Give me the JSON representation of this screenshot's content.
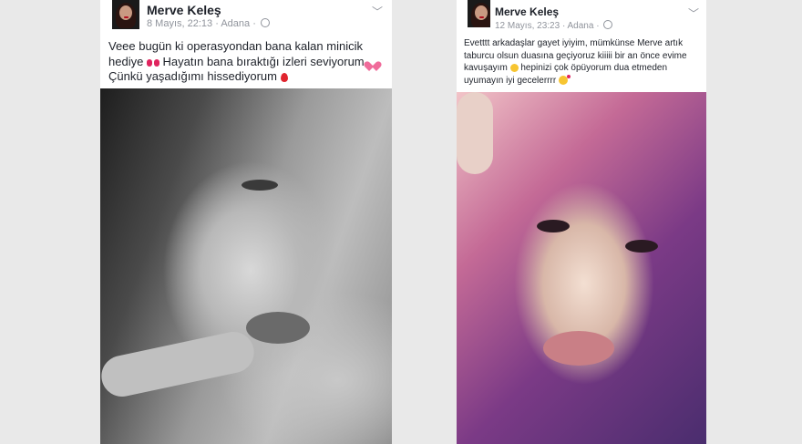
{
  "posts": [
    {
      "author": "Merve Keleş",
      "date": "8 Mayıs, 22:13",
      "sep": "·",
      "location": "Adana",
      "sep2": "·",
      "text_parts": [
        "Veee bugün ki operasyondan bana kalan minicik hediye ",
        " Hayatın bana bıraktığı izleri seviyorum ",
        " Çünkü yaşadığımı hissediyorum "
      ]
    },
    {
      "author": "Merve Keleş",
      "date": "12 Mayıs, 23:23",
      "sep": "·",
      "location": "Adana",
      "sep2": "·",
      "text_parts": [
        "Evetttt arkadaşlar gayet iyiyim, mümkünse Merve artık taburcu olsun duasına geçiyoruz kiiiii bir an önce evime kavuşayım ",
        " hepinizi çok öpüyorum dua etmeden uyumayın iyi gecelerrrr "
      ]
    }
  ],
  "icons": {
    "chevron": "chevron-down-icon",
    "globe": "globe-icon",
    "emoji_post1": [
      "bow-emoji",
      "heart-emoji",
      "balloon-emoji"
    ],
    "emoji_post2": [
      "smile-emoji",
      "kiss-emoji"
    ]
  },
  "colors": {
    "background": "#e9e9e9",
    "card": "#ffffff",
    "name": "#1d2129",
    "meta": "#90949c"
  }
}
